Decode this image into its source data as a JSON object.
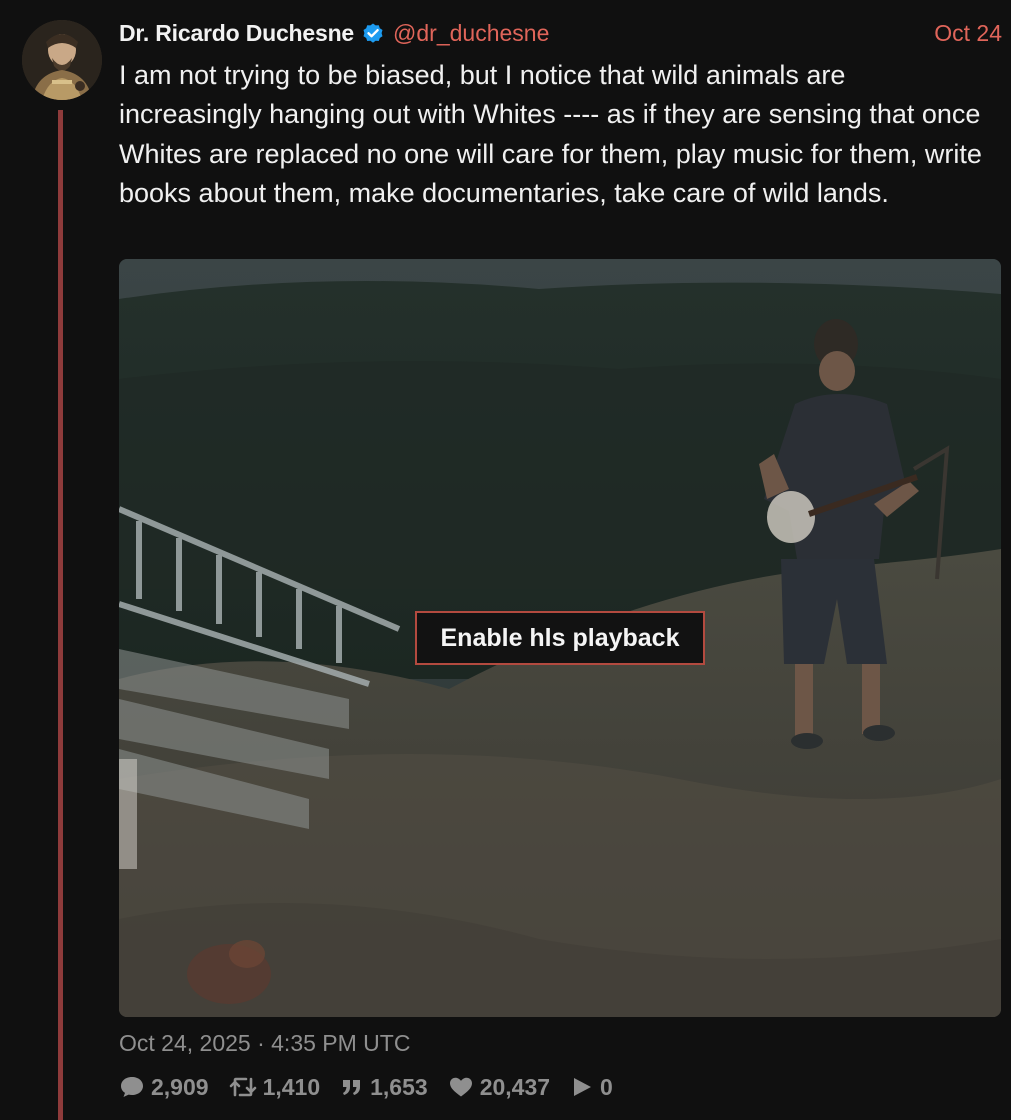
{
  "tweet": {
    "display_name": "Dr. Ricardo Duchesne",
    "handle": "@dr_duchesne",
    "date": "Oct 24",
    "text": "I am not trying to be biased, but I notice that wild animals are increasingly hanging out with Whites ---- as if they are sensing that once Whites are replaced no one will care for them, play music for them, write books about them, make documentaries, take care of wild lands.",
    "media": {
      "button_label": "Enable hls playback"
    },
    "timestamp": "Oct 24, 2025 · 4:35 PM UTC",
    "stats": {
      "replies": "2,909",
      "retweets": "1,410",
      "quotes": "1,653",
      "likes": "20,437",
      "views": "0"
    },
    "colors": {
      "accent": "#e0655a",
      "thread_line": "#8e3b3b",
      "verified": "#1d9bf0",
      "muted": "#8f8f8f"
    },
    "icons": {
      "reply": "comment-icon",
      "retweet": "retweet-icon",
      "quote": "quote-icon",
      "like": "heart-icon",
      "views": "play-icon",
      "verified": "verified-badge-icon"
    }
  }
}
